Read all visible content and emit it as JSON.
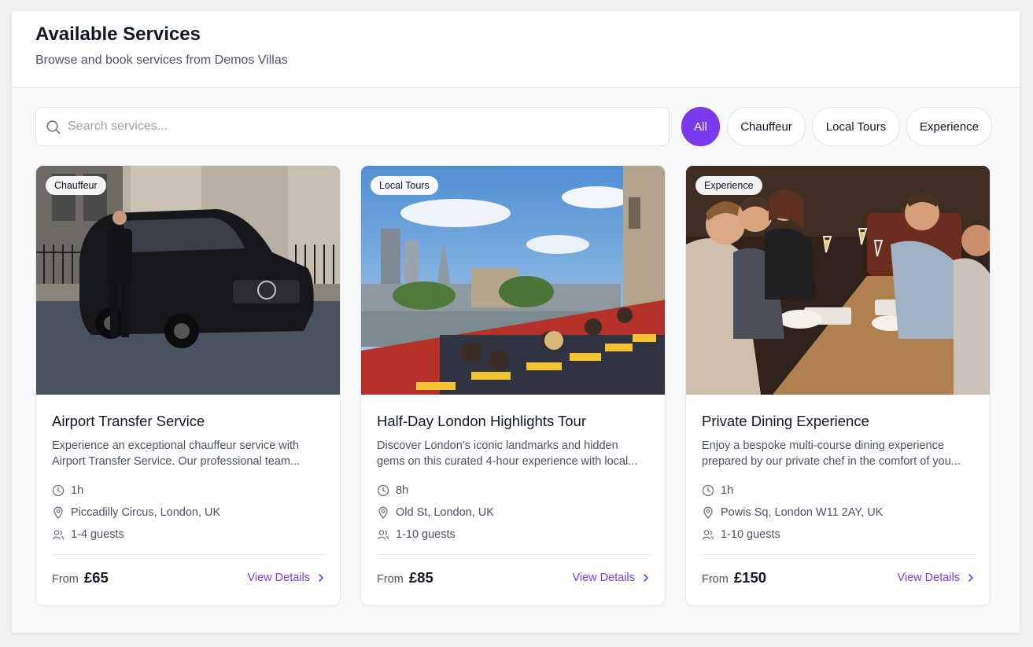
{
  "header": {
    "title": "Available Services",
    "subtitle": "Browse and book services from Demos Villas"
  },
  "search": {
    "placeholder": "Search services...",
    "value": ""
  },
  "filters": [
    {
      "label": "All",
      "active": true
    },
    {
      "label": "Chauffeur",
      "active": false
    },
    {
      "label": "Local Tours",
      "active": false
    },
    {
      "label": "Experience",
      "active": false
    }
  ],
  "colors": {
    "accent": "#7c3aed",
    "page_bg": "#f8f9fb"
  },
  "cards": [
    {
      "tag": "Chauffeur",
      "title": "Airport Transfer Service",
      "desc_line1": "Experience an exceptional chauffeur service with",
      "desc_line2": "Airport Transfer Service. Our professional team...",
      "duration": "1h",
      "location": "Piccadilly Circus, London, UK",
      "guests": "1-4 guests",
      "price_prefix": "From",
      "price": "£65",
      "cta": "View Details",
      "image_icon": "chauffeur-van-photo"
    },
    {
      "tag": "Local Tours",
      "title": "Half-Day London Highlights Tour",
      "desc_line1": "Discover London's iconic landmarks and hidden",
      "desc_line2": "gems on this curated 4-hour experience with local...",
      "duration": "8h",
      "location": "Old St, London, UK",
      "guests": "1-10 guests",
      "price_prefix": "From",
      "price": "£85",
      "cta": "View Details",
      "image_icon": "london-bus-tour-photo"
    },
    {
      "tag": "Experience",
      "title": "Private Dining Experience",
      "desc_line1": "Enjoy a bespoke multi-course dining experience",
      "desc_line2": "prepared by our private chef in the comfort of you...",
      "duration": "1h",
      "location": "Powis Sq, London W11 2AY, UK",
      "guests": "1-10 guests",
      "price_prefix": "From",
      "price": "£150",
      "cta": "View Details",
      "image_icon": "dining-table-photo"
    }
  ]
}
